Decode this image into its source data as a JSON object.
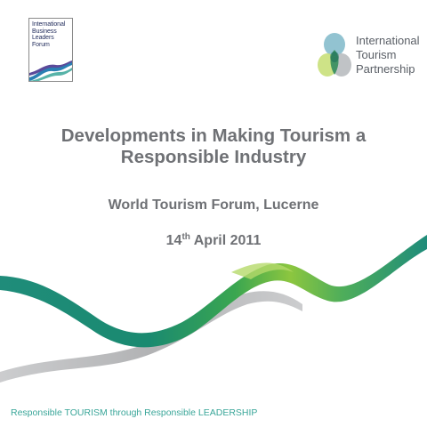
{
  "logos": {
    "iblf": {
      "lines": [
        "International",
        "Business",
        "Leaders",
        "Forum"
      ]
    },
    "itp": {
      "lines": [
        "International",
        "Tourism",
        "Partnership"
      ]
    }
  },
  "slide": {
    "title_lines": [
      "Developments in Making Tourism a",
      "Responsible Industry"
    ],
    "subtitle": "World Tourism Forum, Lucerne",
    "date": {
      "day": "14",
      "suffix": "th",
      "rest": " April 2011"
    }
  },
  "footer": {
    "tagline": "Responsible TOURISM through Responsible LEADERSHIP"
  },
  "colors": {
    "teal": "#1f8c7a",
    "green": "#8cc63f",
    "gray": "#b7b8ba",
    "text_gray": "#6f7175",
    "tagline": "#3aa699",
    "navy": "#1f2a5a"
  }
}
